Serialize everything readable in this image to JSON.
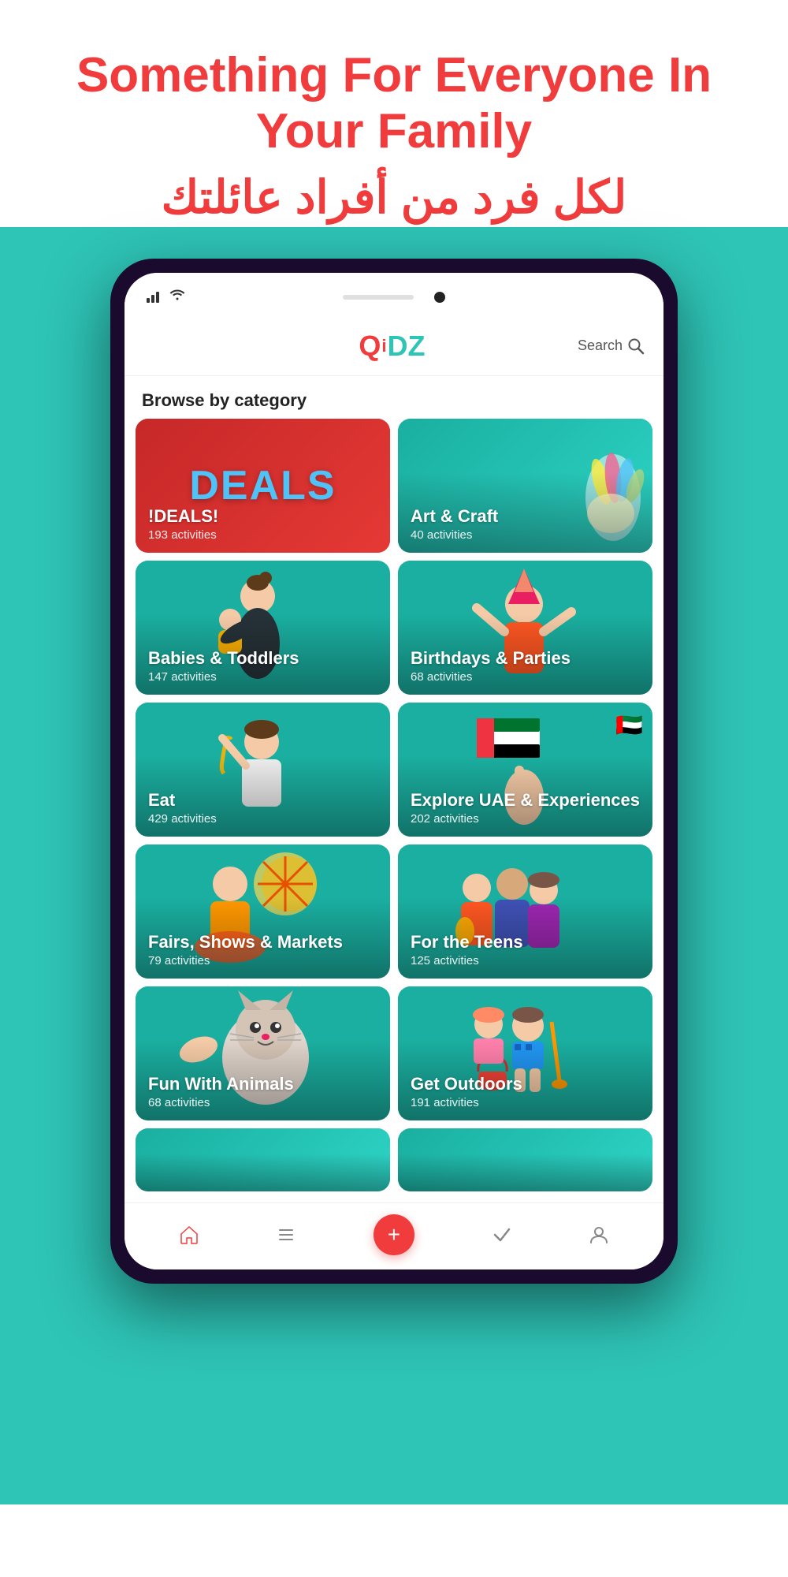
{
  "hero": {
    "title_en": "Something For Everyone In Your Family",
    "title_ar": "لكل فرد من أفراد عائلتك"
  },
  "app": {
    "logo": "QiDZ",
    "search_label": "Search"
  },
  "browse": {
    "section_title": "Browse by category"
  },
  "categories": [
    {
      "id": "deals",
      "title": "!DEALS!",
      "subtitle": "193 activities",
      "style": "deals"
    },
    {
      "id": "art-craft",
      "title": "Art & Craft",
      "subtitle": "40 activities",
      "style": "art"
    },
    {
      "id": "babies-toddlers",
      "title": "Babies & Toddlers",
      "subtitle": "147 activities",
      "style": "babies"
    },
    {
      "id": "birthdays-parties",
      "title": "Birthdays & Parties",
      "subtitle": "68 activities",
      "style": "birthdays"
    },
    {
      "id": "eat",
      "title": "Eat",
      "subtitle": "429 activities",
      "style": "eat"
    },
    {
      "id": "explore-uae",
      "title": "Explore UAE & Experiences",
      "subtitle": "202 activities",
      "style": "explore"
    },
    {
      "id": "fairs-shows",
      "title": "Fairs, Shows & Markets",
      "subtitle": "79 activities",
      "style": "fairs"
    },
    {
      "id": "for-teens",
      "title": "For the Teens",
      "subtitle": "125 activities",
      "style": "teens"
    },
    {
      "id": "fun-animals",
      "title": "Fun With Animals",
      "subtitle": "68 activities",
      "style": "animals"
    },
    {
      "id": "get-outdoors",
      "title": "Get Outdoors",
      "subtitle": "191 activities",
      "style": "outdoors"
    }
  ],
  "bottom_nav": [
    {
      "id": "home",
      "icon": "🏠",
      "active": true
    },
    {
      "id": "list",
      "icon": "☰",
      "active": false
    },
    {
      "id": "add",
      "icon": "+",
      "active": false,
      "special": true
    },
    {
      "id": "check",
      "icon": "✓",
      "active": false
    },
    {
      "id": "profile",
      "icon": "👤",
      "active": false
    }
  ]
}
